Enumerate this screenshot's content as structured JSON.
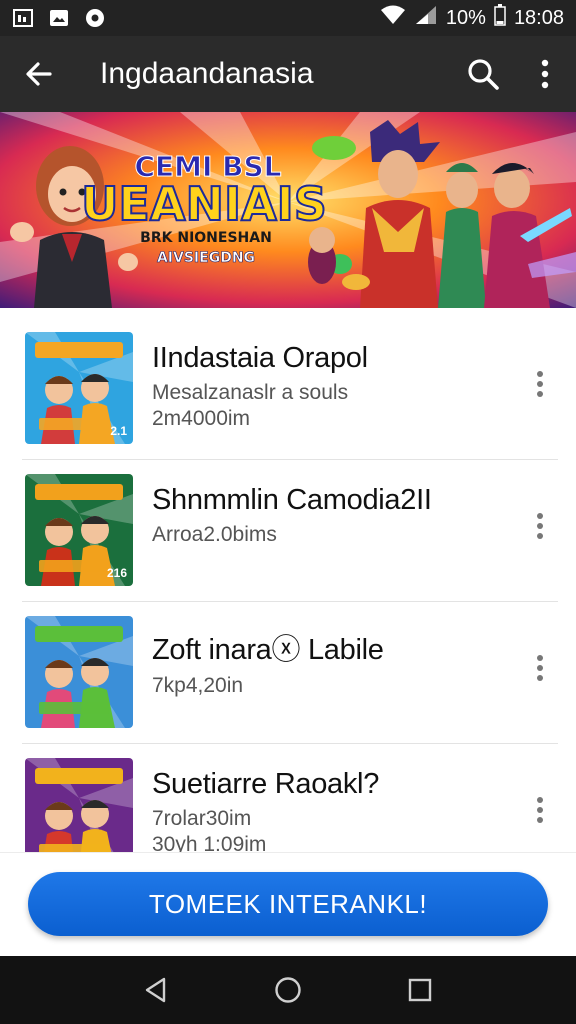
{
  "status_bar": {
    "battery": "10%",
    "time": "18:08",
    "icons": [
      "gallery-icon",
      "photo-icon",
      "music-icon",
      "wifi-icon",
      "signal-icon",
      "battery-icon"
    ]
  },
  "app_bar": {
    "title": "Ingdaandanasia",
    "back_icon": "arrow-back-icon",
    "search_icon": "search-icon",
    "more_icon": "more-vert-icon"
  },
  "banner": {
    "line1": "CEMI BSL",
    "line2": "UEANIAIS",
    "line3": "BRK NIONESHAN",
    "line4": "AIVSIEGDNG"
  },
  "list": {
    "items": [
      {
        "title": "IIndastaia Orapol",
        "subtitle": "Mesalzanaslr a souls",
        "meta": "2m4000im",
        "thumb_badge": "2.1",
        "colors": [
          "#2fa4e0",
          "#f4a623",
          "#d23c3c"
        ]
      },
      {
        "title": "Shnmmlin Camodia2II",
        "subtitle": "Arroa2.0bims",
        "meta": "",
        "thumb_badge": "216",
        "colors": [
          "#1b6f3d",
          "#f2a11c",
          "#c9321a"
        ]
      },
      {
        "title": "Zoft inaraⓧ Labile",
        "subtitle": "7kp4,20in",
        "meta": "",
        "thumb_badge": "",
        "colors": [
          "#3b8fd8",
          "#5bbf3a",
          "#e24a7a"
        ]
      },
      {
        "title": "Suetiarre Raoakl?",
        "subtitle": "7rolar30im",
        "meta": "30уh 1:09im",
        "thumb_badge": "",
        "colors": [
          "#6a2a8a",
          "#f2b21c",
          "#d5382b"
        ]
      }
    ]
  },
  "cta": {
    "label": "TOMEEK INTERANKL!"
  },
  "nav": {
    "back": "nav-back-icon",
    "home": "nav-home-icon",
    "recents": "nav-recents-icon"
  }
}
